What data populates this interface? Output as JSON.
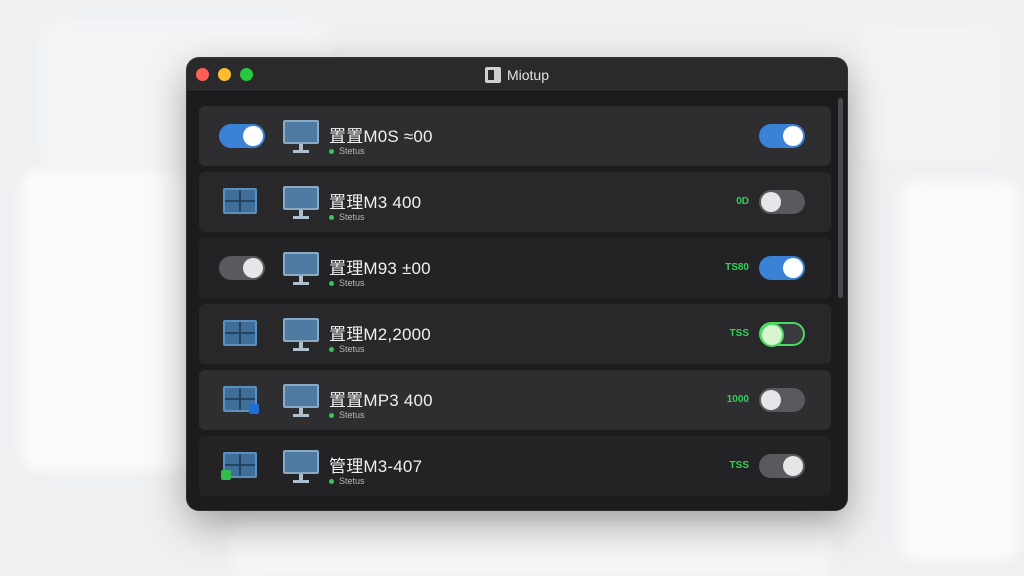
{
  "window": {
    "title": "Miotup"
  },
  "rows": [
    {
      "name": "置置M0S ≈00",
      "status": "Stetus",
      "tag": ""
    },
    {
      "name": "置理M3 400",
      "status": "Stetus",
      "tag": "0D"
    },
    {
      "name": "置理M93 ±00",
      "status": "Stetus",
      "tag": "ТS80"
    },
    {
      "name": "置理M2,2000",
      "status": "Stetus",
      "tag": "TSS"
    },
    {
      "name": "置置MP3 400",
      "status": "Stetus",
      "tag": "1000"
    },
    {
      "name": "管理M3-407",
      "status": "Stetus",
      "tag": "TSS"
    }
  ],
  "colors": {
    "accent_blue": "#3b82d6",
    "status_green": "#34c759",
    "tag_green": "#30d158"
  }
}
